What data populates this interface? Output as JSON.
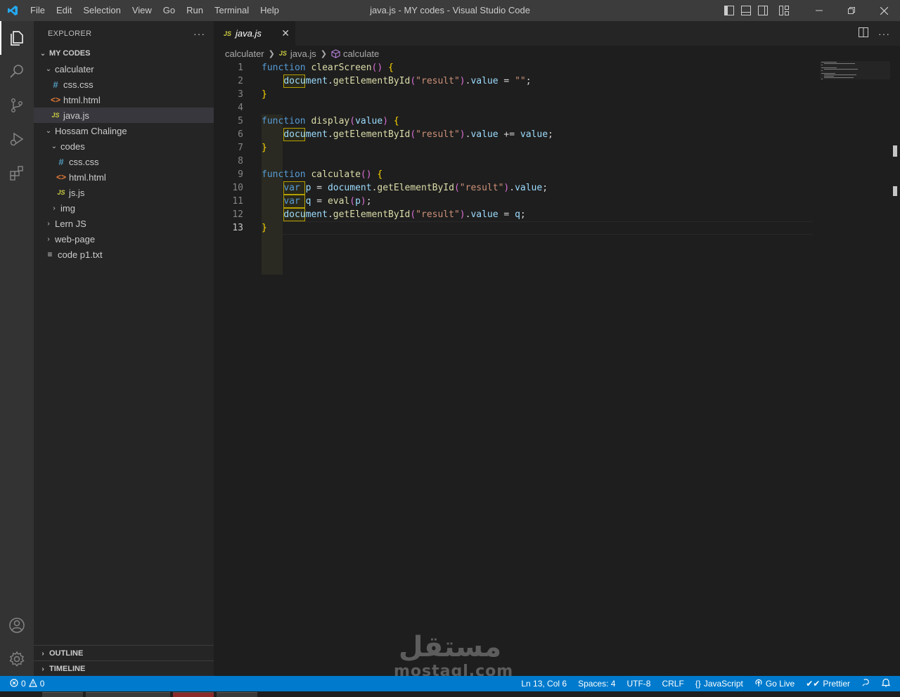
{
  "window": {
    "title": "java.js - MY codes - Visual Studio Code",
    "menu": [
      "File",
      "Edit",
      "Selection",
      "View",
      "Go",
      "Run",
      "Terminal",
      "Help"
    ],
    "icons": [
      "vscode-logo-icon",
      "toggle-sidebar-icon",
      "toggle-panel-icon",
      "toggle-secondary-sidebar-icon",
      "customize-layout-icon",
      "minimize-icon",
      "restore-icon",
      "close-icon"
    ]
  },
  "activity_bar": {
    "top": [
      "explorer-icon",
      "search-icon",
      "source-control-icon",
      "run-debug-icon",
      "extensions-icon"
    ],
    "bottom": [
      "accounts-icon",
      "manage-gear-icon"
    ]
  },
  "explorer": {
    "title": "EXPLORER",
    "more": "···",
    "root": "MY CODES",
    "tree": [
      {
        "label": "calculater",
        "type": "folder",
        "depth": 1,
        "open": true
      },
      {
        "label": "css.css",
        "type": "css",
        "depth": 2
      },
      {
        "label": "html.html",
        "type": "html",
        "depth": 2
      },
      {
        "label": "java.js",
        "type": "js",
        "depth": 2,
        "selected": true
      },
      {
        "label": "Hossam Chalinge",
        "type": "folder",
        "depth": 1,
        "open": true
      },
      {
        "label": "codes",
        "type": "folder",
        "depth": 2,
        "open": true
      },
      {
        "label": "css.css",
        "type": "css",
        "depth": 3
      },
      {
        "label": "html.html",
        "type": "html",
        "depth": 3
      },
      {
        "label": "js.js",
        "type": "js",
        "depth": 3
      },
      {
        "label": "img",
        "type": "folder",
        "depth": 2,
        "open": false
      },
      {
        "label": "Lern JS",
        "type": "folder",
        "depth": 1,
        "open": false
      },
      {
        "label": "web-page",
        "type": "folder",
        "depth": 1,
        "open": false
      },
      {
        "label": "code p1.txt",
        "type": "txt",
        "depth": 1
      }
    ],
    "outline": "OUTLINE",
    "timeline": "TIMELINE"
  },
  "editor": {
    "tab_label": "java.js",
    "tab_icon": "JS",
    "tab_close": "✕",
    "breadcrumb": [
      "calculater",
      "java.js",
      "calculate"
    ],
    "current_line": 13,
    "lines": [
      "function clearScreen() {",
      "    document.getElementById(\"result\").value = \"\";",
      "}",
      "",
      "function display(value) {",
      "    document.getElementById(\"result\").value += value;",
      "}",
      "",
      "function calculate() {",
      "    var p = document.getElementById(\"result\").value;",
      "    var q = eval(p);",
      "    document.getElementById(\"result\").value = q;",
      "}"
    ]
  },
  "status_bar": {
    "errors": "0",
    "warnings": "0",
    "position": "Ln 13, Col 6",
    "spaces": "Spaces: 4",
    "encoding": "UTF-8",
    "eol": "CRLF",
    "language": "JavaScript",
    "go_live": "Go Live",
    "prettier": "Prettier"
  },
  "watermark": {
    "arabic": "مستقل",
    "latin": "mostaql.com"
  },
  "colors": {
    "accent": "#007acc",
    "titlebar": "#3c3c3c",
    "sidebar": "#252526",
    "editor": "#1e1e1e",
    "keyword": "#569cd6",
    "function": "#dcdcaa",
    "string": "#ce9178",
    "variable": "#9cdcfe",
    "bracket": "#ffd700"
  }
}
